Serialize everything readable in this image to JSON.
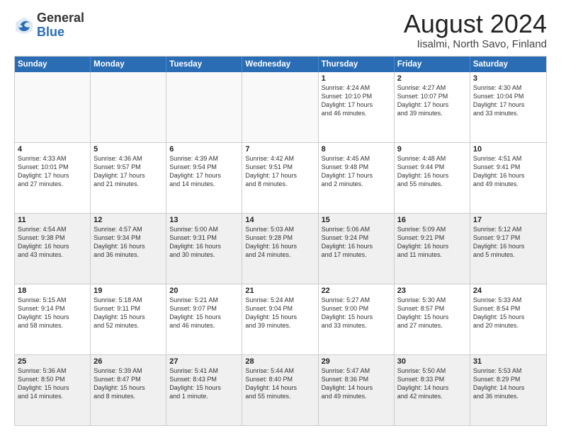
{
  "logo": {
    "general": "General",
    "blue": "Blue"
  },
  "title": "August 2024",
  "subtitle": "Iisalmi, North Savo, Finland",
  "days": [
    "Sunday",
    "Monday",
    "Tuesday",
    "Wednesday",
    "Thursday",
    "Friday",
    "Saturday"
  ],
  "rows": [
    [
      {
        "day": "",
        "content": ""
      },
      {
        "day": "",
        "content": ""
      },
      {
        "day": "",
        "content": ""
      },
      {
        "day": "",
        "content": ""
      },
      {
        "day": "1",
        "content": "Sunrise: 4:24 AM\nSunset: 10:10 PM\nDaylight: 17 hours\nand 46 minutes."
      },
      {
        "day": "2",
        "content": "Sunrise: 4:27 AM\nSunset: 10:07 PM\nDaylight: 17 hours\nand 39 minutes."
      },
      {
        "day": "3",
        "content": "Sunrise: 4:30 AM\nSunset: 10:04 PM\nDaylight: 17 hours\nand 33 minutes."
      }
    ],
    [
      {
        "day": "4",
        "content": "Sunrise: 4:33 AM\nSunset: 10:01 PM\nDaylight: 17 hours\nand 27 minutes."
      },
      {
        "day": "5",
        "content": "Sunrise: 4:36 AM\nSunset: 9:57 PM\nDaylight: 17 hours\nand 21 minutes."
      },
      {
        "day": "6",
        "content": "Sunrise: 4:39 AM\nSunset: 9:54 PM\nDaylight: 17 hours\nand 14 minutes."
      },
      {
        "day": "7",
        "content": "Sunrise: 4:42 AM\nSunset: 9:51 PM\nDaylight: 17 hours\nand 8 minutes."
      },
      {
        "day": "8",
        "content": "Sunrise: 4:45 AM\nSunset: 9:48 PM\nDaylight: 17 hours\nand 2 minutes."
      },
      {
        "day": "9",
        "content": "Sunrise: 4:48 AM\nSunset: 9:44 PM\nDaylight: 16 hours\nand 55 minutes."
      },
      {
        "day": "10",
        "content": "Sunrise: 4:51 AM\nSunset: 9:41 PM\nDaylight: 16 hours\nand 49 minutes."
      }
    ],
    [
      {
        "day": "11",
        "content": "Sunrise: 4:54 AM\nSunset: 9:38 PM\nDaylight: 16 hours\nand 43 minutes."
      },
      {
        "day": "12",
        "content": "Sunrise: 4:57 AM\nSunset: 9:34 PM\nDaylight: 16 hours\nand 36 minutes."
      },
      {
        "day": "13",
        "content": "Sunrise: 5:00 AM\nSunset: 9:31 PM\nDaylight: 16 hours\nand 30 minutes."
      },
      {
        "day": "14",
        "content": "Sunrise: 5:03 AM\nSunset: 9:28 PM\nDaylight: 16 hours\nand 24 minutes."
      },
      {
        "day": "15",
        "content": "Sunrise: 5:06 AM\nSunset: 9:24 PM\nDaylight: 16 hours\nand 17 minutes."
      },
      {
        "day": "16",
        "content": "Sunrise: 5:09 AM\nSunset: 9:21 PM\nDaylight: 16 hours\nand 11 minutes."
      },
      {
        "day": "17",
        "content": "Sunrise: 5:12 AM\nSunset: 9:17 PM\nDaylight: 16 hours\nand 5 minutes."
      }
    ],
    [
      {
        "day": "18",
        "content": "Sunrise: 5:15 AM\nSunset: 9:14 PM\nDaylight: 15 hours\nand 58 minutes."
      },
      {
        "day": "19",
        "content": "Sunrise: 5:18 AM\nSunset: 9:11 PM\nDaylight: 15 hours\nand 52 minutes."
      },
      {
        "day": "20",
        "content": "Sunrise: 5:21 AM\nSunset: 9:07 PM\nDaylight: 15 hours\nand 46 minutes."
      },
      {
        "day": "21",
        "content": "Sunrise: 5:24 AM\nSunset: 9:04 PM\nDaylight: 15 hours\nand 39 minutes."
      },
      {
        "day": "22",
        "content": "Sunrise: 5:27 AM\nSunset: 9:00 PM\nDaylight: 15 hours\nand 33 minutes."
      },
      {
        "day": "23",
        "content": "Sunrise: 5:30 AM\nSunset: 8:57 PM\nDaylight: 15 hours\nand 27 minutes."
      },
      {
        "day": "24",
        "content": "Sunrise: 5:33 AM\nSunset: 8:54 PM\nDaylight: 15 hours\nand 20 minutes."
      }
    ],
    [
      {
        "day": "25",
        "content": "Sunrise: 5:36 AM\nSunset: 8:50 PM\nDaylight: 15 hours\nand 14 minutes."
      },
      {
        "day": "26",
        "content": "Sunrise: 5:39 AM\nSunset: 8:47 PM\nDaylight: 15 hours\nand 8 minutes."
      },
      {
        "day": "27",
        "content": "Sunrise: 5:41 AM\nSunset: 8:43 PM\nDaylight: 15 hours\nand 1 minute."
      },
      {
        "day": "28",
        "content": "Sunrise: 5:44 AM\nSunset: 8:40 PM\nDaylight: 14 hours\nand 55 minutes."
      },
      {
        "day": "29",
        "content": "Sunrise: 5:47 AM\nSunset: 8:36 PM\nDaylight: 14 hours\nand 49 minutes."
      },
      {
        "day": "30",
        "content": "Sunrise: 5:50 AM\nSunset: 8:33 PM\nDaylight: 14 hours\nand 42 minutes."
      },
      {
        "day": "31",
        "content": "Sunrise: 5:53 AM\nSunset: 8:29 PM\nDaylight: 14 hours\nand 36 minutes."
      }
    ]
  ]
}
